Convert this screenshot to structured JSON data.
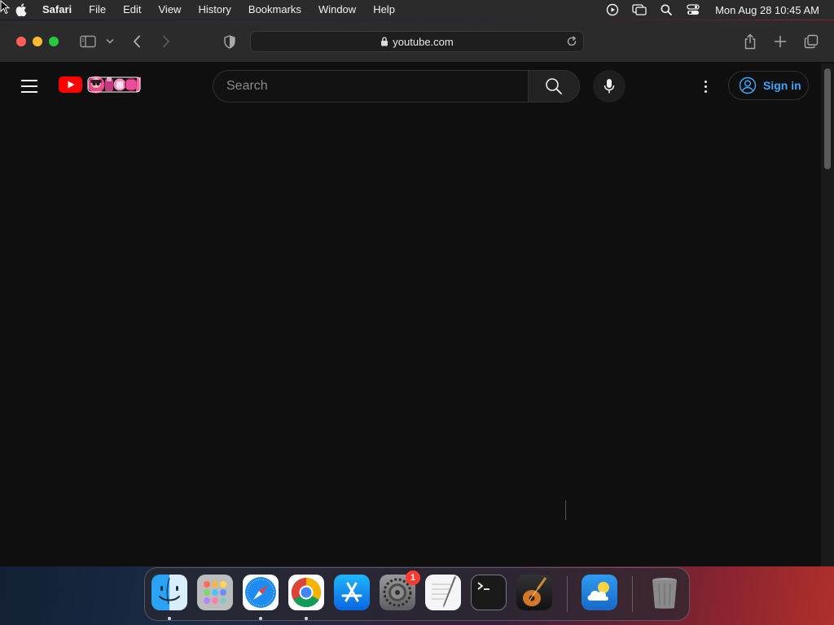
{
  "menubar": {
    "app_name": "Safari",
    "menus": [
      "File",
      "Edit",
      "View",
      "History",
      "Bookmarks",
      "Window",
      "Help"
    ],
    "clock": "Mon Aug 28  10:45 AM",
    "status_icons": [
      "screen-recording-icon",
      "screen-mirroring-icon",
      "spotlight-search-icon",
      "control-center-icon"
    ]
  },
  "browser": {
    "url": "youtube.com"
  },
  "youtube": {
    "search_placeholder": "Search",
    "signin_label": "Sign in",
    "colors": {
      "brand_red": "#ff0000",
      "link_blue": "#3ea6ff",
      "background": "#0f0f0f"
    }
  },
  "dock": {
    "apps": [
      "Finder",
      "Launchpad",
      "Safari",
      "Google Chrome",
      "App Store",
      "System Settings",
      "TextEdit",
      "Terminal",
      "GarageBand",
      "Weather",
      "Trash"
    ],
    "system_settings_badge": "1"
  }
}
